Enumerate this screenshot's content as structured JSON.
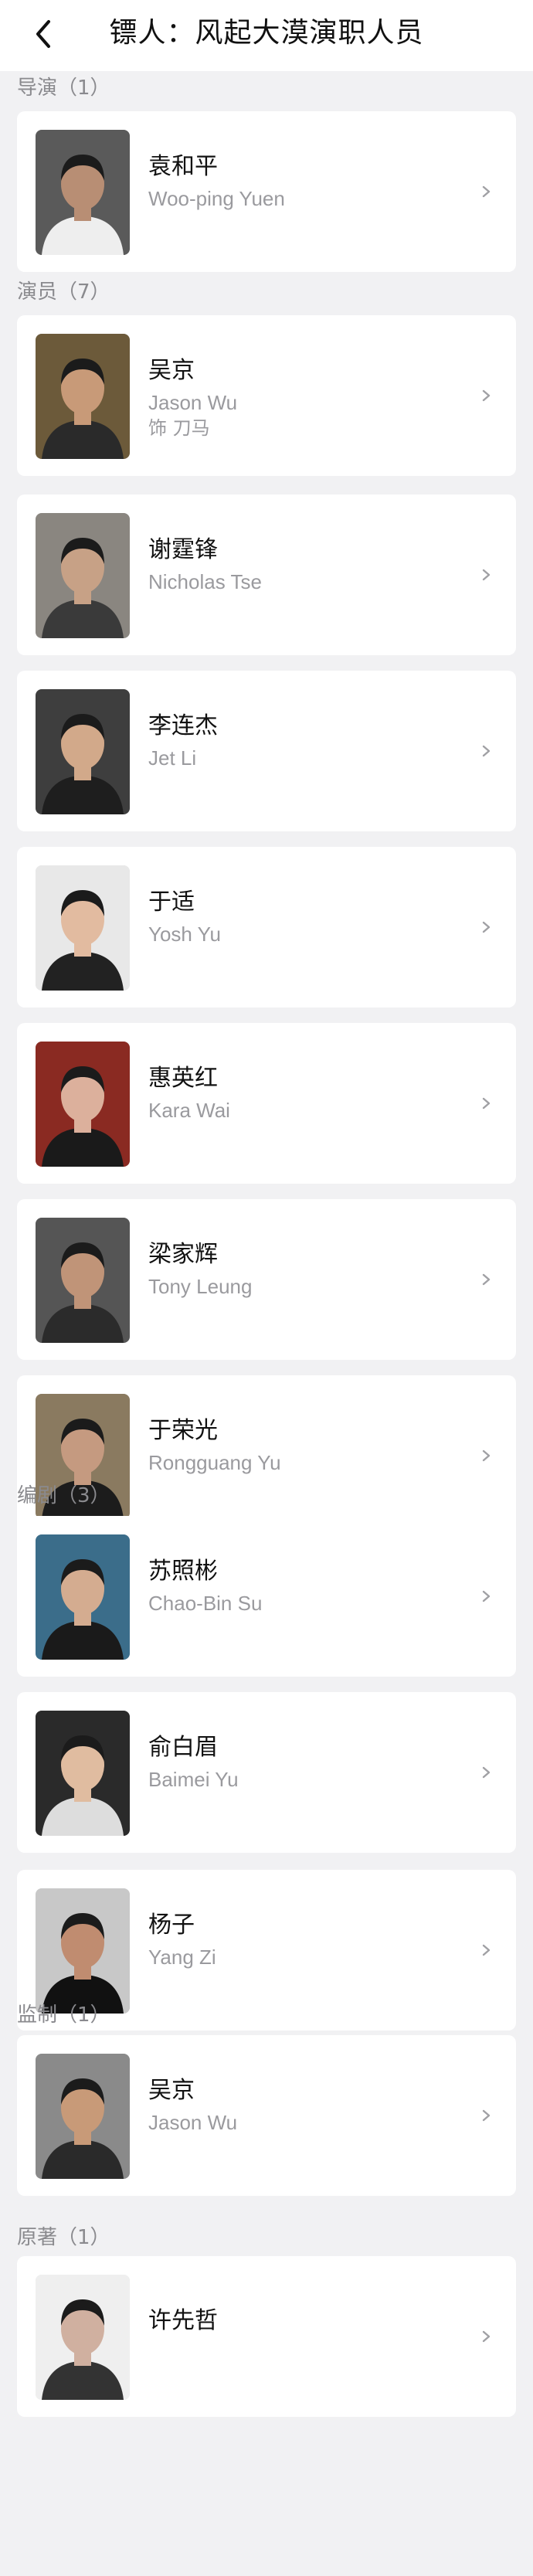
{
  "header": {
    "title": "镖人：风起大漠演职人员",
    "back_icon": "chevron-left-icon"
  },
  "sections": [
    {
      "label": "导演（1）",
      "people": [
        {
          "name": "袁和平",
          "en": "Woo-ping Yuen",
          "role": ""
        }
      ]
    },
    {
      "label": "演员（7）",
      "people": [
        {
          "name": "吴京",
          "en": "Jason Wu",
          "role": "饰 刀马"
        },
        {
          "name": "谢霆锋",
          "en": "Nicholas Tse",
          "role": ""
        },
        {
          "name": "李连杰",
          "en": "Jet Li",
          "role": ""
        },
        {
          "name": "于适",
          "en": "Yosh Yu",
          "role": ""
        },
        {
          "name": "惠英红",
          "en": "Kara Wai",
          "role": ""
        },
        {
          "name": "梁家辉",
          "en": "Tony Leung",
          "role": ""
        },
        {
          "name": "于荣光",
          "en": "Rongguang Yu",
          "role": ""
        }
      ]
    },
    {
      "label": "编剧（3）",
      "people": [
        {
          "name": "苏照彬",
          "en": "Chao-Bin Su",
          "role": ""
        },
        {
          "name": "俞白眉",
          "en": "Baimei Yu",
          "role": ""
        },
        {
          "name": "杨子",
          "en": "Yang Zi",
          "role": ""
        }
      ]
    },
    {
      "label": "监制（1）",
      "people": [
        {
          "name": "吴京",
          "en": "Jason Wu",
          "role": ""
        }
      ]
    },
    {
      "label": "原著（1）",
      "people": [
        {
          "name": "许先哲",
          "en": "",
          "role": ""
        }
      ]
    }
  ],
  "colors": {
    "background": "#f1f1f3",
    "card": "#ffffff",
    "primary_text": "#111111",
    "secondary_text": "#9a9a9e"
  }
}
